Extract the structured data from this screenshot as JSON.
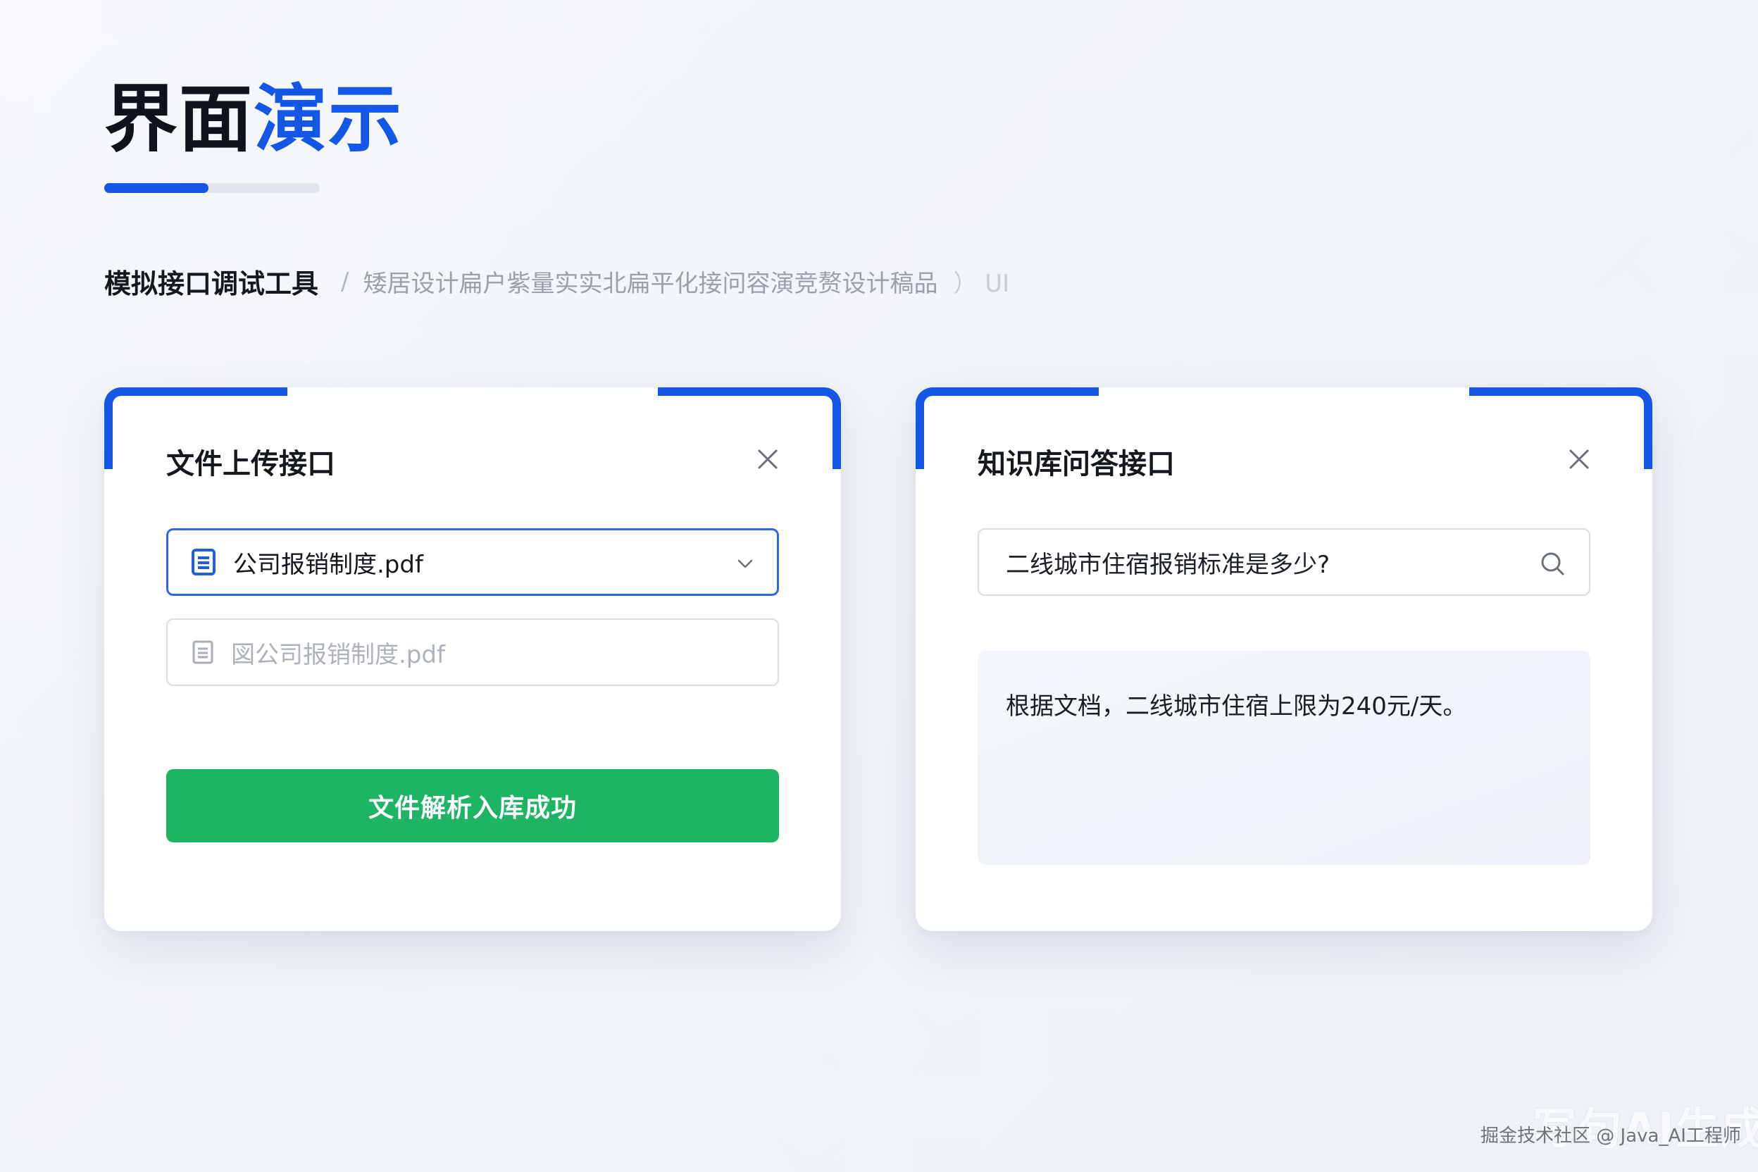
{
  "page": {
    "title_part1": "界面",
    "title_part2": "演示",
    "subtitle_main": "模拟接口调试工具",
    "subtitle_separator": "/",
    "subtitle_desc": "矮居设计扁户紫量实实北扁平化接问容演竞赘设计稿品",
    "subtitle_tail": "）  UI"
  },
  "colors": {
    "accent": "#1456e6",
    "success": "#1db464",
    "card_background": "#ffffff",
    "page_background": "#f1f4f8"
  },
  "upload_card": {
    "title": "文件上传接口",
    "close_icon": "close-icon",
    "file_select": {
      "icon": "document-icon",
      "value": "公司报销制度.pdf",
      "dropdown_icon": "chevron-down-icon"
    },
    "file_ghost": {
      "icon": "document-icon",
      "value": "図公司报销制度.pdf"
    },
    "action_button": "文件解析入库成功"
  },
  "qa_card": {
    "title": "知识库问答接口",
    "close_icon": "close-icon",
    "search": {
      "value": "二线城市住宿报销标准是多少?",
      "icon": "search-icon"
    },
    "answer": "根据文档，二线城市住宿上限为240元/天。"
  },
  "watermark": {
    "logo_text": "写句AI生成",
    "credit": "掘金技术社区 @ Java_AI工程师"
  }
}
